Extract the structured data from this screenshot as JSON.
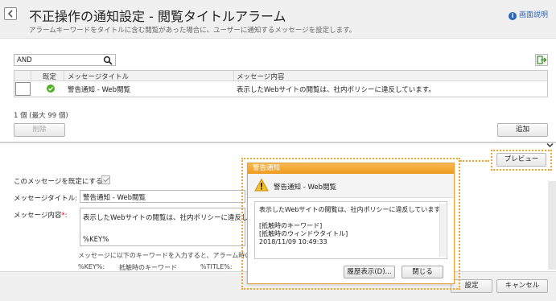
{
  "header": {
    "back_icon": "back-arrow-icon",
    "title": "不正操作の通知設定 - 閲覧タイトルアラーム",
    "description": "アラームキーワードをタイトルに含む閲覧があった場合に、ユーザーに通知するメッセージを設定します。",
    "help_label": "画面説明"
  },
  "search": {
    "value": "AND",
    "icon": "search-icon"
  },
  "table": {
    "columns": [
      "既定",
      "メッセージタイトル",
      "メッセージ内容"
    ],
    "rows": [
      {
        "default": true,
        "title": "警告通知 - Web閲覧",
        "content": "表示したWebサイトの閲覧は、社内ポリシーに違反しています。"
      }
    ]
  },
  "list_footer": {
    "count": "1 個 (最大 99 個)",
    "delete_label": "削除",
    "add_label": "追加"
  },
  "form": {
    "default_label": "このメッセージを既定にする:",
    "default_checked": true,
    "title_label": "メッセージタイトル:",
    "title_value": "警告通知 - Web閲覧",
    "content_label": "メッセージ内容",
    "required_mark": "*",
    "content_colon": ":",
    "content_line1": "表示したWebサイトの閲覧は、社内ポリシーに違反しています",
    "content_line2": "%KEY%",
    "note": "メッセージに以下のキーワードを入力すると、アラーム時の各情報",
    "keywords": [
      "%KEY%:",
      "抵触時のキーワード",
      "%TITLE%:"
    ],
    "save_label": "設定",
    "cancel_label": "キャンセル"
  },
  "preview_button": "プレビュー",
  "popup": {
    "window_title": "警告通知",
    "warning_icon": "warning-triangle-icon",
    "subject": "警告通知 - Web閲覧",
    "lines": [
      "表示したWebサイトの閲覧は、社内ポリシーに違反しています。",
      "",
      "[抵触時のキーワード]",
      "[抵触時のウィンドウタイトル]",
      "2018/11/09 10:49:33"
    ],
    "history_label": "履歴表示(D)...",
    "close_label": "閉じる"
  },
  "colors": {
    "accent_orange": "#f2a42c",
    "check_green": "#4caf28",
    "link_blue": "#2a66b8",
    "required_red": "#d0021b"
  }
}
